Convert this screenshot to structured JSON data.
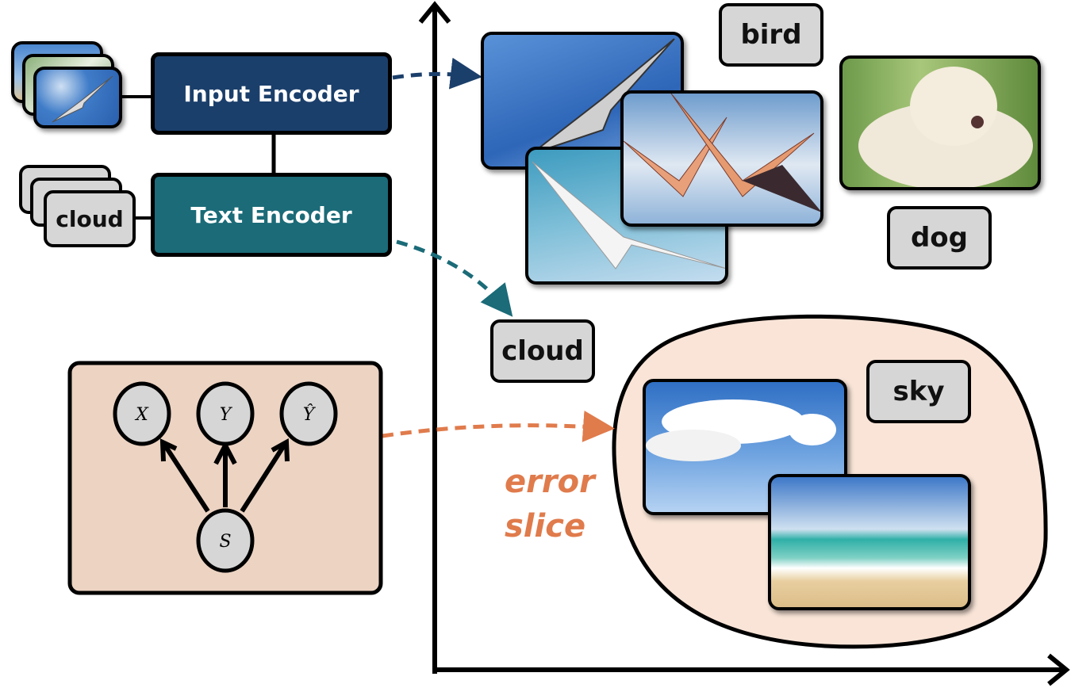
{
  "colors": {
    "input_encoder": "#1b3f6b",
    "text_encoder": "#1b6b78",
    "panel_fill": "#ecd3c2",
    "slice_fill": "#f9e4d7",
    "error_accent": "#e07b4c",
    "label_fill": "#d6d6d6"
  },
  "encoders": {
    "input": "Input Encoder",
    "text": "Text Encoder"
  },
  "inputs": {
    "text_stack_label": "cloud",
    "image_stack_description": "stack of input photos (bird in sky on top)"
  },
  "causal_graph": {
    "nodes": [
      "X",
      "Y",
      "Ŷ",
      "S"
    ],
    "edges": [
      [
        "S",
        "X"
      ],
      [
        "S",
        "Y"
      ],
      [
        "S",
        "Ŷ"
      ]
    ]
  },
  "embedding_space": {
    "labels": {
      "bird": "bird",
      "dog": "dog",
      "cloud": "cloud",
      "sky": "sky"
    },
    "photos": {
      "gull_sky": "seagull in blue sky",
      "white_gull": "white gull in cloudy sky",
      "spoonbills": "two spoonbills flying",
      "dog": "white dog in grass",
      "clouds": "clouds in blue sky",
      "beach": "beach and ocean"
    }
  },
  "error_slice": {
    "line1": "error",
    "line2": "slice"
  }
}
